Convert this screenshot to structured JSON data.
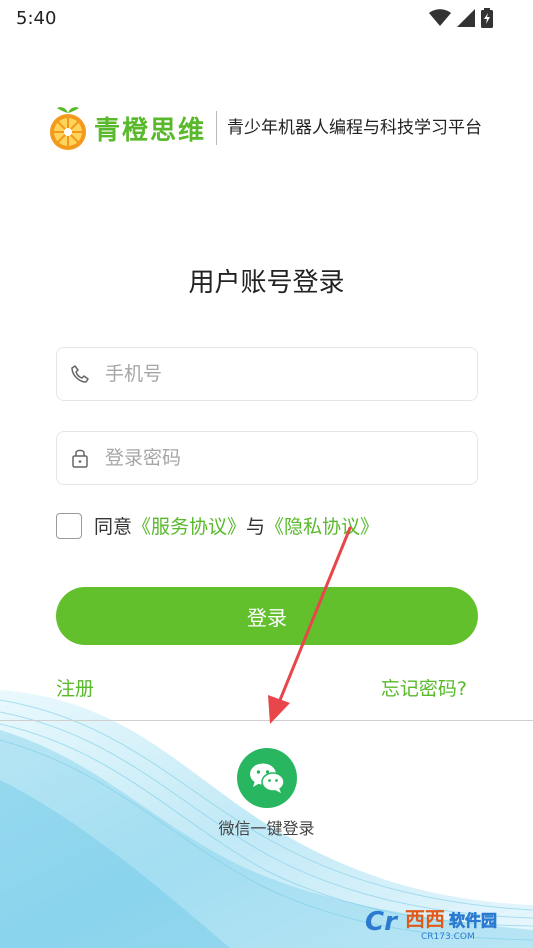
{
  "status_bar": {
    "time": "5:40"
  },
  "brand": {
    "name": "青橙思维",
    "slogan": "青少年机器人编程与科技学习平台"
  },
  "login": {
    "title": "用户账号登录",
    "phone_placeholder": "手机号",
    "password_placeholder": "登录密码",
    "agree_prefix": "同意",
    "terms_link": "《服务协议》",
    "conjunction": "与",
    "privacy_link": "《隐私协议》",
    "login_button": "登录",
    "register_link": "注册",
    "forgot_link": "忘记密码?"
  },
  "wechat": {
    "label": "微信一键登录"
  },
  "watermark": {
    "text": "西西软件园",
    "url": "CR173.COM"
  },
  "colors": {
    "accent": "#62c02d",
    "wechat": "#28b760",
    "arrow": "#e8464a"
  }
}
